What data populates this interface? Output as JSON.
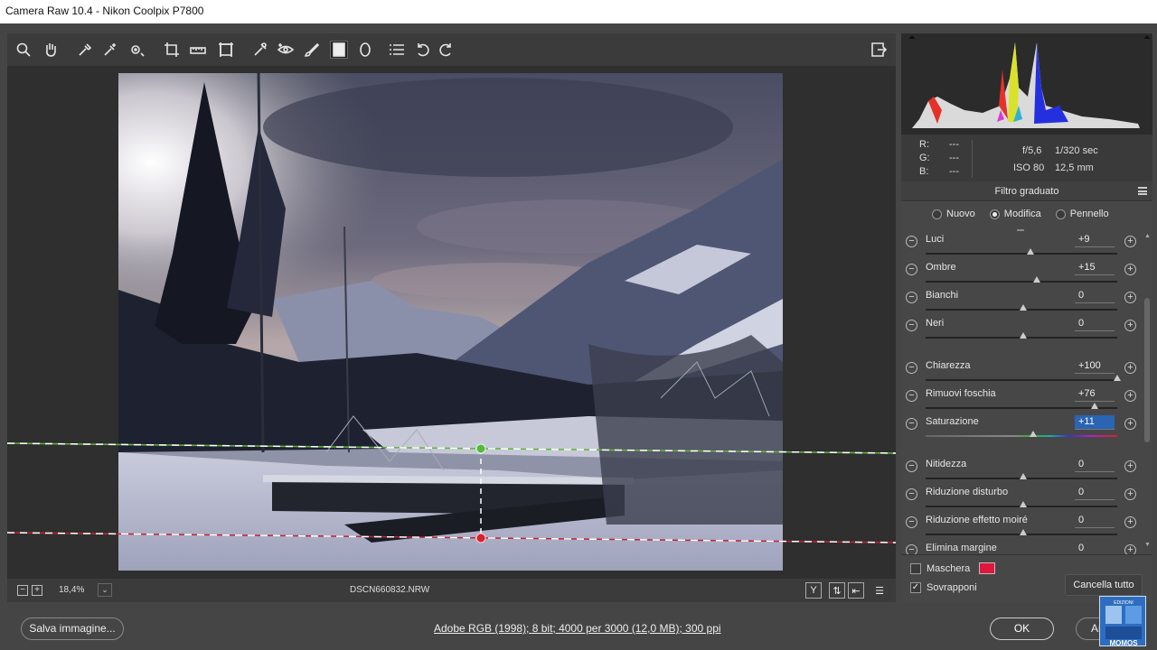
{
  "window": {
    "title": "Camera Raw 10.4  -  Nikon Coolpix P7800"
  },
  "toolbar": {
    "tools": [
      "zoom-icon",
      "hand-icon",
      "white-balance-icon",
      "color-sampler-icon",
      "targeted-adjustment-icon",
      "crop-icon",
      "straighten-icon",
      "transform-icon",
      "spot-removal-icon",
      "red-eye-icon",
      "adjustment-brush-icon",
      "graduated-filter-icon",
      "radial-filter-icon",
      "preferences-icon",
      "rotate-left-icon",
      "rotate-right-icon"
    ],
    "active_tool": "graduated-filter-icon"
  },
  "statusbar": {
    "zoom": "18,4%",
    "filename": "DSCN660832.NRW"
  },
  "info": {
    "r_label": "R:",
    "g_label": "G:",
    "b_label": "B:",
    "r_value": "---",
    "g_value": "---",
    "b_value": "---",
    "aperture": "f/5,6",
    "shutter": "1/320 sec",
    "iso": "ISO 80",
    "focal": "12,5 mm"
  },
  "panel": {
    "title": "Filtro graduato",
    "modes": [
      {
        "label": "Nuovo",
        "selected": false
      },
      {
        "label": "Modifica",
        "selected": true
      },
      {
        "label": "Pennello",
        "selected": false
      }
    ],
    "sliders": [
      {
        "label": "Luci",
        "value": "+9",
        "position": 0.54
      },
      {
        "label": "Ombre",
        "value": "+15",
        "position": 0.57
      },
      {
        "label": "Bianchi",
        "value": "0",
        "position": 0.5
      },
      {
        "label": "Neri",
        "value": "0",
        "position": 0.5
      },
      {
        "label": "Chiarezza",
        "value": "+100",
        "position": 1.0
      },
      {
        "label": "Rimuovi foschia",
        "value": "+76",
        "position": 0.88
      },
      {
        "label": "Saturazione",
        "value": "+11",
        "position": 0.555
      },
      {
        "label": "Nitidezza",
        "value": "0",
        "position": 0.5
      },
      {
        "label": "Riduzione disturbo",
        "value": "0",
        "position": 0.5
      },
      {
        "label": "Riduzione effetto moiré",
        "value": "0",
        "position": 0.5
      },
      {
        "label": "Elimina margine",
        "value": "0",
        "position": 0.5
      }
    ]
  },
  "mask": {
    "mask_label": "Maschera",
    "mask_checked": false,
    "mask_color": "#e0163f",
    "overlay_label": "Sovrapponi",
    "overlay_checked": true,
    "clear_label": "Cancella tutto"
  },
  "bottom": {
    "save_label": "Salva immagine...",
    "workflow": "Adobe RGB (1998); 8 bit; 4000 per 3000 (12,0 MB); 300 ppi",
    "ok_label": "OK",
    "cancel_label": "An"
  }
}
